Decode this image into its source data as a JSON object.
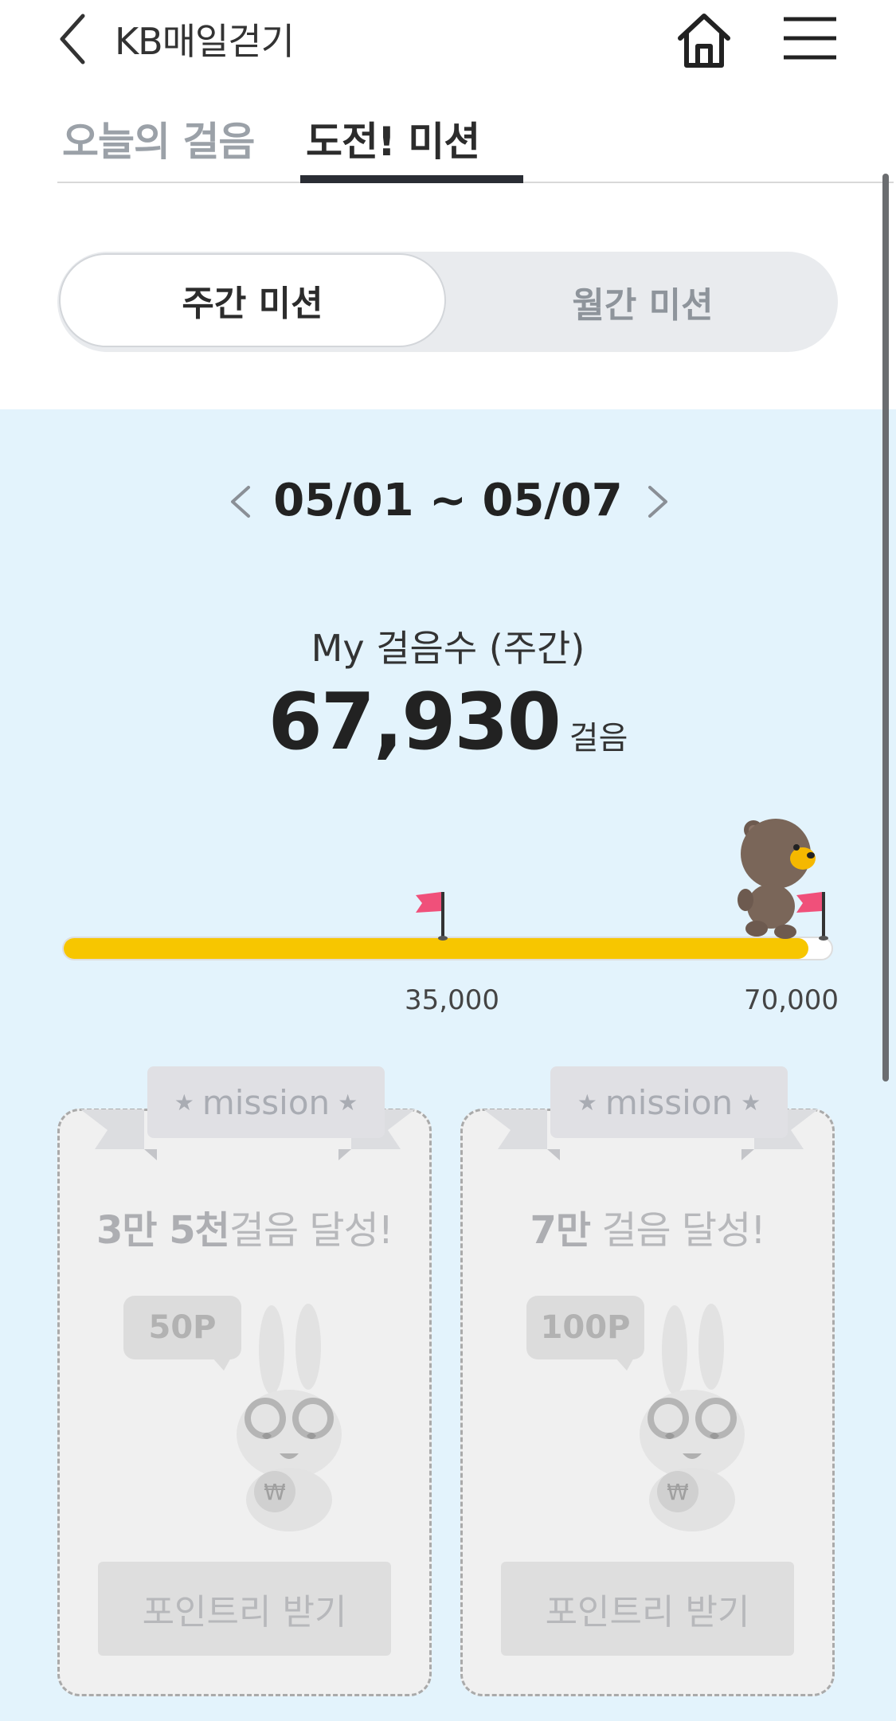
{
  "header": {
    "title": "KB매일걷기",
    "back_icon": "chevron-left-icon",
    "home_icon": "home-icon",
    "menu_icon": "hamburger-menu-icon"
  },
  "tabs": [
    {
      "label": "오늘의 걸음",
      "active": false
    },
    {
      "label": "도전! 미션",
      "active": true
    }
  ],
  "segment": {
    "options": [
      {
        "label": "주간 미션",
        "selected": true
      },
      {
        "label": "월간 미션",
        "selected": false
      }
    ]
  },
  "period": {
    "range": "05/01 ~ 05/07"
  },
  "steps": {
    "label": "My 걸음수 (주간)",
    "value": "67,930",
    "unit": "걸음"
  },
  "progress": {
    "fraction": 0.9704,
    "milestones": [
      "35,000",
      "70,000"
    ],
    "fill_color": "#f7c600",
    "flag_color": "#f0507a"
  },
  "missions": [
    {
      "ribbon": "mission",
      "title_bold": "3만 5천",
      "title_rest": "걸음 달성!",
      "reward": "50P",
      "button": "포인트리 받기"
    },
    {
      "ribbon": "mission",
      "title_bold": "7만",
      "title_rest": " 걸음 달성!",
      "reward": "100P",
      "button": "포인트리 받기"
    }
  ],
  "colors": {
    "panel_bg": "#e3f3fc",
    "active_tab": "#2a2d34"
  }
}
